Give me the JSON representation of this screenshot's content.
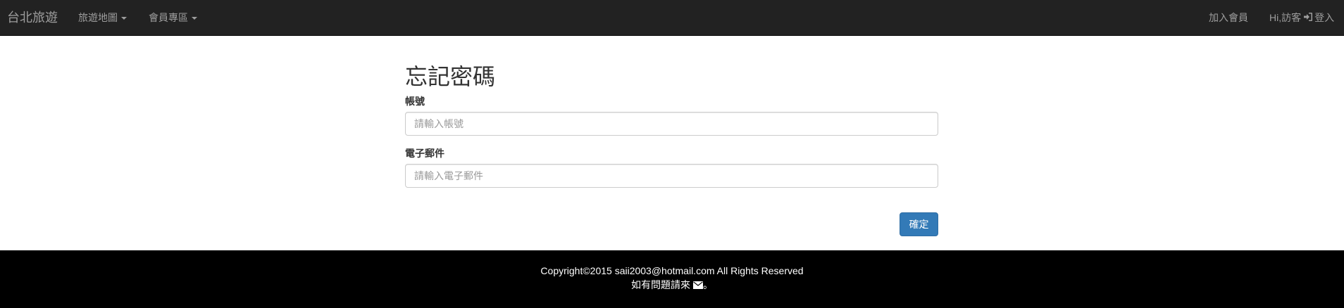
{
  "navbar": {
    "brand": "台北旅遊",
    "menu_travel_map": "旅遊地圖",
    "menu_member_area": "會員專區",
    "join_member": "加入會員",
    "greeting": "Hi,訪客",
    "login": "登入"
  },
  "form": {
    "title": "忘記密碼",
    "account_label": "帳號",
    "account_placeholder": "請輸入帳號",
    "account_value": "",
    "email_label": "電子郵件",
    "email_placeholder": "請輸入電子郵件",
    "email_value": "",
    "submit_label": "確定"
  },
  "footer": {
    "copyright": "Copyright©2015 saii2003@hotmail.com All Rights Reserved",
    "contact_prefix": "如有問題請來",
    "contact_suffix": "。"
  },
  "colors": {
    "navbar_bg": "#222222",
    "navbar_text": "#9d9d9d",
    "primary_button": "#337ab7",
    "footer_bg": "#000000"
  },
  "icons": {
    "login": "sign-in-icon",
    "mail": "envelope-icon",
    "dropdown": "caret-down-icon"
  }
}
